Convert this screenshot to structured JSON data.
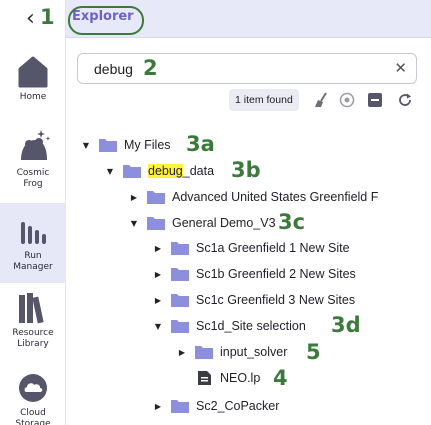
{
  "header": {
    "title": "Explorer"
  },
  "rail": {
    "items": [
      {
        "label": "Home",
        "icon": "home-icon"
      },
      {
        "label": "Cosmic Frog",
        "icon": "frog-icon"
      },
      {
        "label": "Run Manager",
        "icon": "run-manager-icon"
      },
      {
        "label": "Resource Library",
        "icon": "library-icon"
      },
      {
        "label": "Cloud Storage",
        "icon": "cloud-storage-icon"
      }
    ]
  },
  "search": {
    "value": "debug"
  },
  "toolbar": {
    "found_label": "1 item found"
  },
  "tree": [
    {
      "name": "My Files"
    },
    {
      "name_highlight": "debug",
      "name_rest": "_data"
    },
    {
      "name": "Advanced United States Greenfield F"
    },
    {
      "name": "General Demo_V3"
    },
    {
      "name": "Sc1a Greenfield 1 New Site"
    },
    {
      "name": "Sc1b Greenfield 2 New Sites"
    },
    {
      "name": "Sc1c Greenfield 3 New Sites"
    },
    {
      "name": "Sc1d_Site selection"
    },
    {
      "name": "input_solver"
    },
    {
      "name": "NEO.lp"
    },
    {
      "name": "Sc2_CoPacker"
    }
  ],
  "annotations": {
    "a1": "1",
    "a2": "2",
    "a3a": "3a",
    "a3b": "3b",
    "a3c": "3c",
    "a3d": "3d",
    "a4": "4",
    "a5": "5"
  },
  "colors": {
    "accent": "#6b63c9",
    "folder": "#8c8fdc",
    "annotation": "#3c7a3c",
    "highlight": "#fff23a"
  }
}
